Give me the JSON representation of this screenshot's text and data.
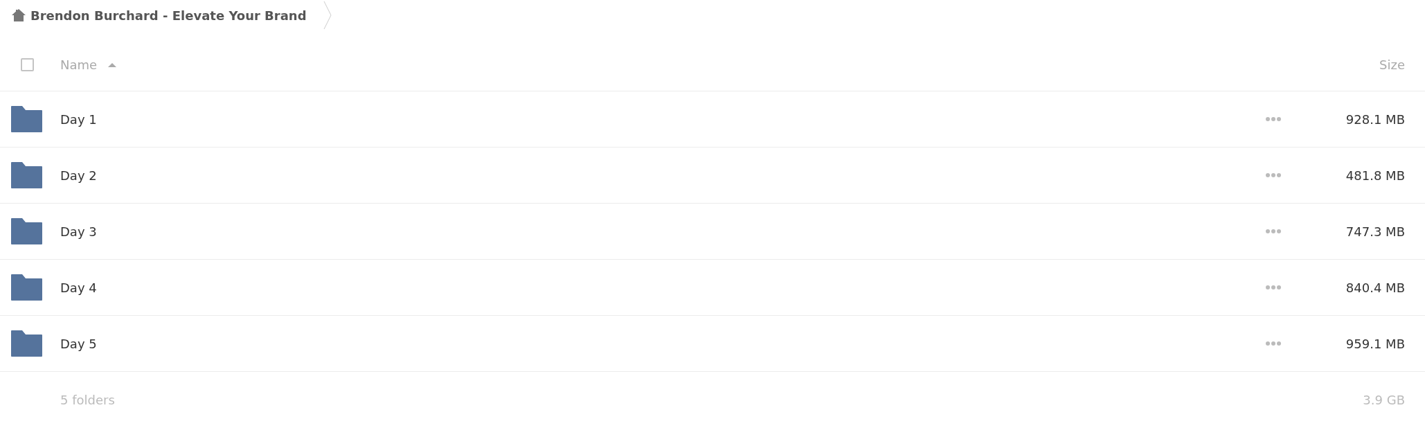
{
  "breadcrumb": {
    "title": "Brendon Burchard - Elevate Your Brand"
  },
  "header": {
    "select_all_checked": false,
    "name_label": "Name",
    "name_sorted_ascending": true,
    "size_label": "Size"
  },
  "rows": [
    {
      "name": "Day 1",
      "size": "928.1 MB",
      "selected": false
    },
    {
      "name": "Day 2",
      "size": "481.8 MB",
      "selected": false
    },
    {
      "name": "Day 3",
      "size": "747.3 MB",
      "selected": false
    },
    {
      "name": "Day 4",
      "size": "840.4 MB",
      "selected": false
    },
    {
      "name": "Day 5",
      "size": "959.1 MB",
      "selected": false
    }
  ],
  "summary": {
    "count": "5 folders",
    "total": "3.9 GB"
  }
}
